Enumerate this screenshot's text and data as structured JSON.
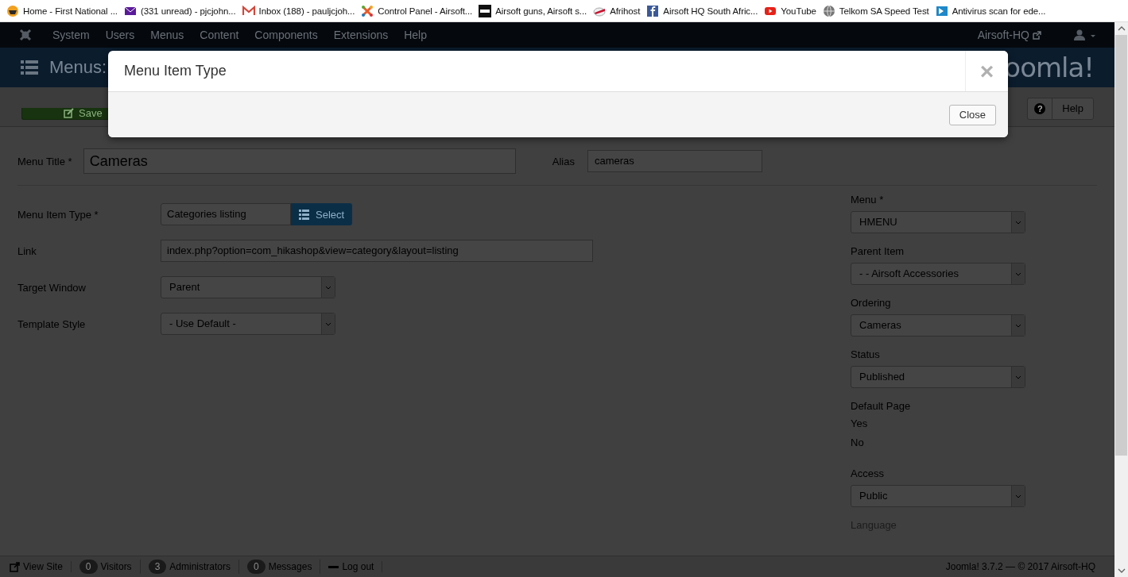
{
  "bookmarks": [
    {
      "label": "Home - First National ..."
    },
    {
      "label": "(331 unread) - pjcjohn..."
    },
    {
      "label": "Inbox (188) - pauljcjoh..."
    },
    {
      "label": "Control Panel - Airsoft..."
    },
    {
      "label": "Airsoft guns, Airsoft s..."
    },
    {
      "label": "Afrihost"
    },
    {
      "label": "Airsoft HQ South Afric..."
    },
    {
      "label": "YouTube"
    },
    {
      "label": "Telkom SA Speed Test"
    },
    {
      "label": "Antivirus scan for ede..."
    }
  ],
  "admin_nav": {
    "items": [
      "System",
      "Users",
      "Menus",
      "Content",
      "Components",
      "Extensions",
      "Help"
    ],
    "site_link": "Airsoft-HQ"
  },
  "header": {
    "title": "Menus:",
    "logo_text": "oomla!"
  },
  "toolbar": {
    "save": "Save",
    "help_icon": "?",
    "help": "Help"
  },
  "form": {
    "title_label": "Menu Title *",
    "title_value": "Cameras",
    "alias_label": "Alias",
    "alias_value": "cameras",
    "left_fields": [
      {
        "kind": "picker",
        "label": "Menu Item Type *",
        "value": "Categories listing",
        "button": "Select"
      },
      {
        "kind": "text",
        "label": "Link",
        "value": "index.php?option=com_hikashop&view=category&layout=listing"
      },
      {
        "kind": "select",
        "label": "Target Window",
        "value": "Parent"
      },
      {
        "kind": "select",
        "label": "Template Style",
        "value": "- Use Default -"
      }
    ],
    "right_fields": [
      {
        "kind": "select",
        "label": "Menu *",
        "value": "HMENU"
      },
      {
        "kind": "select",
        "label": "Parent Item",
        "value": "- - Airsoft Accessories"
      },
      {
        "kind": "select",
        "label": "Ordering",
        "value": "Cameras"
      },
      {
        "kind": "select",
        "label": "Status",
        "value": "Published"
      },
      {
        "kind": "options",
        "label": "Default Page",
        "options": [
          "Yes",
          "No"
        ]
      },
      {
        "kind": "select",
        "label": "Access",
        "value": "Public"
      },
      {
        "kind": "label",
        "label": "Language"
      }
    ]
  },
  "status_bar": {
    "items": [
      {
        "kind": "link",
        "label": "View Site"
      },
      {
        "kind": "count",
        "count": "0",
        "label": "Visitors"
      },
      {
        "kind": "count",
        "count": "3",
        "label": "Administrators"
      },
      {
        "kind": "count",
        "count": "0",
        "label": "Messages"
      },
      {
        "kind": "logout",
        "label": "Log out"
      }
    ],
    "version": "Joomla! 3.7.2 — © 2017 Airsoft-HQ"
  },
  "modal": {
    "title": "Menu Item Type",
    "close_symbol": "×",
    "close_button": "Close"
  }
}
